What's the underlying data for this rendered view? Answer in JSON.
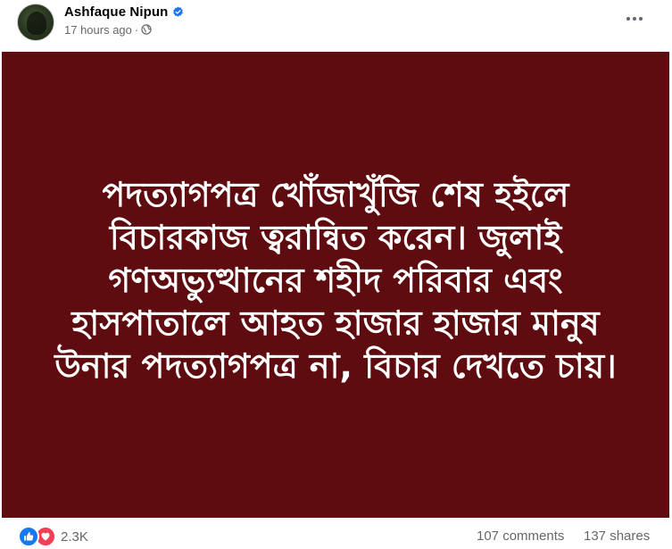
{
  "post": {
    "author": {
      "name": "Ashfaque Nipun",
      "verified": true
    },
    "timestamp": "17 hours ago",
    "separator": "·",
    "audience_icon": "globe-icon",
    "more_icon": "more-options-icon"
  },
  "image": {
    "background_color": "#5e0c0f",
    "text_color": "#ffffff",
    "lines": [
      "পদত্যাগপত্র খোঁজাখুঁজি শেষ হইলে",
      "বিচারকাজ ত্বরান্বিত করেন। জুলাই",
      "গণঅভ্যুত্থানের শহীদ পরিবার এবং",
      "হাসপাতালে আহত হাজার হাজার মানুষ",
      "উনার পদত্যাগপত্র না, বিচার দেখতে চায়।"
    ]
  },
  "footer": {
    "reaction_icons": [
      "like-icon",
      "love-icon"
    ],
    "reaction_count": "2.3K",
    "comments": "107 comments",
    "shares": "137 shares"
  },
  "colors": {
    "name_text": "#050505",
    "meta_text": "#65676b",
    "verified_blue": "#1877f2",
    "like_blue": "#1877f2",
    "love_red": "#f33e58"
  }
}
